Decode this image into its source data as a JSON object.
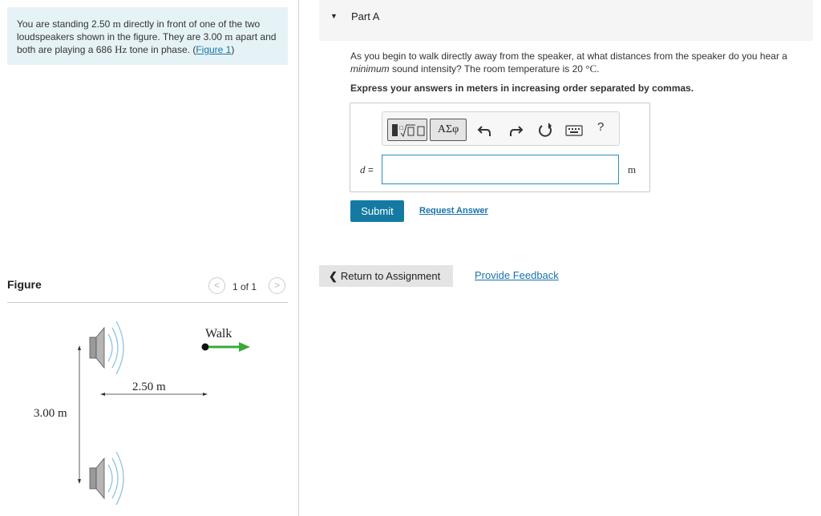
{
  "problem": {
    "text_1": "You are standing 2.50 ",
    "unit_m_1": "m",
    "text_2": " directly in front of one of the two loudspeakers shown in the figure. They are 3.00 ",
    "unit_m_2": "m",
    "text_3": " apart and both are playing a 686 ",
    "unit_hz": "Hz",
    "text_4": " tone in phase. (",
    "figure_link": "Figure 1",
    "text_5": ")"
  },
  "figure": {
    "title": "Figure",
    "pager_prev": "<",
    "pager_label": "1 of 1",
    "pager_next": ">",
    "walk_label": "Walk",
    "distance_label": "2.50 m",
    "separation_label": "3.00 m",
    "arrow_color": "#3aa83a",
    "wave_color": "#8cc4e6"
  },
  "part": {
    "caret": "▼",
    "title": "Part A"
  },
  "question": {
    "text_1": "As you begin to walk directly away from the speaker, at what distances from the speaker do you hear a ",
    "emphasis": "minimum",
    "text_2": " sound intensity? The room temperature is 20 ",
    "unit_temp": "°C",
    "text_3": "."
  },
  "instruction": "Express your answers in meters in increasing order separated by commas.",
  "toolbar": {
    "symbols_label": "ΑΣφ",
    "help_label": "?"
  },
  "answer": {
    "var_name": "d",
    "equals": " =",
    "value": "",
    "unit": "m"
  },
  "actions": {
    "submit_label": "Submit",
    "request_label": "Request Answer",
    "return_chevron": "❮",
    "return_label": "Return to Assignment",
    "feedback_label": "Provide Feedback"
  },
  "colors": {
    "accent": "#157aa3",
    "link": "#1a73a8",
    "problem_bg": "#e6f3f6"
  }
}
